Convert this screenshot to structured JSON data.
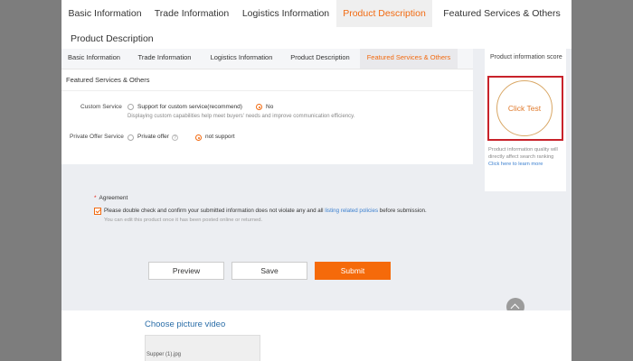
{
  "top_tabs": [
    {
      "label": "Basic Information",
      "active": false
    },
    {
      "label": "Trade Information",
      "active": false
    },
    {
      "label": "Logistics Information",
      "active": false
    },
    {
      "label": "Product Description",
      "active": true
    },
    {
      "label": "Featured Services & Others",
      "active": false
    }
  ],
  "page_title": "Product Description",
  "inner_tabs": [
    {
      "label": "Basic Information",
      "active": false
    },
    {
      "label": "Trade Information",
      "active": false
    },
    {
      "label": "Logistics Information",
      "active": false
    },
    {
      "label": "Product Description",
      "active": false
    },
    {
      "label": "Featured Services & Others",
      "active": true
    }
  ],
  "section_title": "Featured Services & Others",
  "custom_service": {
    "label": "Custom Service",
    "options": [
      {
        "label": "Support for custom service(recommend)",
        "selected": false
      },
      {
        "label": "No",
        "selected": true
      }
    ],
    "hint": "Displaying custom capabilities help meet buyers' needs and improve communication efficiency."
  },
  "private_offer": {
    "label": "Private Offer Service",
    "options": [
      {
        "label": "Private offer",
        "selected": false
      },
      {
        "label": "not support",
        "selected": true
      }
    ],
    "help_icon": "question-circle-icon"
  },
  "score_panel": {
    "title": "Product information score",
    "button": "Click Test",
    "note": "Product information quality will directly affect search ranking",
    "link": "Click here to learn more"
  },
  "agreement": {
    "required_mark": "*",
    "title": "Agreement",
    "checked": true,
    "text_before": "Please double check and confirm your submitted information does not violate any and all",
    "link": "listing related policies",
    "text_after": "before submission.",
    "hint": "You can edit this product once it has been posted online or returned."
  },
  "buttons": {
    "preview": "Preview",
    "save": "Save",
    "submit": "Submit"
  },
  "media": {
    "title": "Choose picture video",
    "file_name": "Supper (1).jpg"
  },
  "colors": {
    "accent": "#f26a10",
    "link": "#3a7fcf",
    "highlight_border": "#c8222a"
  }
}
